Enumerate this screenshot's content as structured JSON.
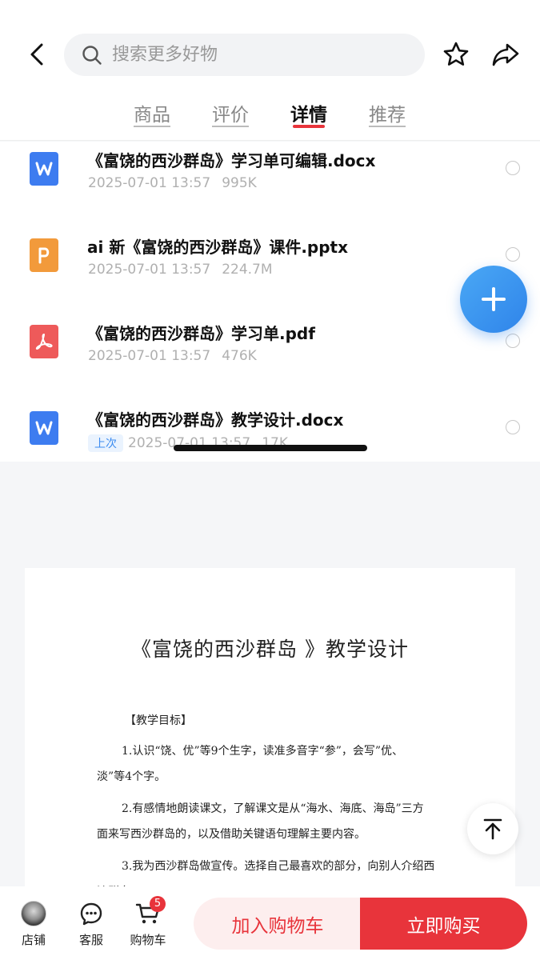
{
  "search": {
    "placeholder": "搜索更多好物"
  },
  "tabs": [
    {
      "label": "商品"
    },
    {
      "label": "评价"
    },
    {
      "label": "详情",
      "active": true
    },
    {
      "label": "推荐"
    }
  ],
  "files": [
    {
      "name": "《富饶的西沙群岛》学习单可编辑.docx",
      "date": "2025-07-01 13:57",
      "size": "995K",
      "type": "word",
      "icon": "word-icon"
    },
    {
      "name": "ai 新《富饶的西沙群岛》课件.pptx",
      "date": "2025-07-01 13:57",
      "size": "224.7M",
      "type": "ppt",
      "icon": "ppt-icon"
    },
    {
      "name": "《富饶的西沙群岛》学习单.pdf",
      "date": "2025-07-01 13:57",
      "size": "476K",
      "type": "pdf",
      "icon": "pdf-icon"
    },
    {
      "name": "《富饶的西沙群岛》教学设计.docx",
      "date": "2025-07-01 13:57",
      "size": "17K",
      "type": "word",
      "icon": "word-icon",
      "badge": "上次"
    }
  ],
  "doc": {
    "title": "《富饶的西沙群岛 》教学设计",
    "heading": "【教学目标】",
    "lines": [
      "1.认识“饶、优”等9个生字，读准多音字“参”，会写”优、",
      "淡”等4个字。",
      "2.有感情地朗读课文，了解课文是从“海水、海底、海岛”三方",
      "面来写西沙群岛的，以及借助关键语句理解主要内容。",
      "3.我为西沙群岛做宣传。选择自己最喜欢的部分，向别人介绍西",
      "沙群岛。"
    ]
  },
  "bottom": {
    "store_label": "店铺",
    "service_label": "客服",
    "cart_label": "购物车",
    "cart_count": "5",
    "add_cart_label": "加入购物车",
    "buy_now_label": "立即购买"
  },
  "colors": {
    "accent": "#e8343b",
    "word": "#3d7cf0",
    "ppt": "#f29a3b",
    "pdf": "#ee5a5a",
    "fab": "#3d91ef"
  }
}
